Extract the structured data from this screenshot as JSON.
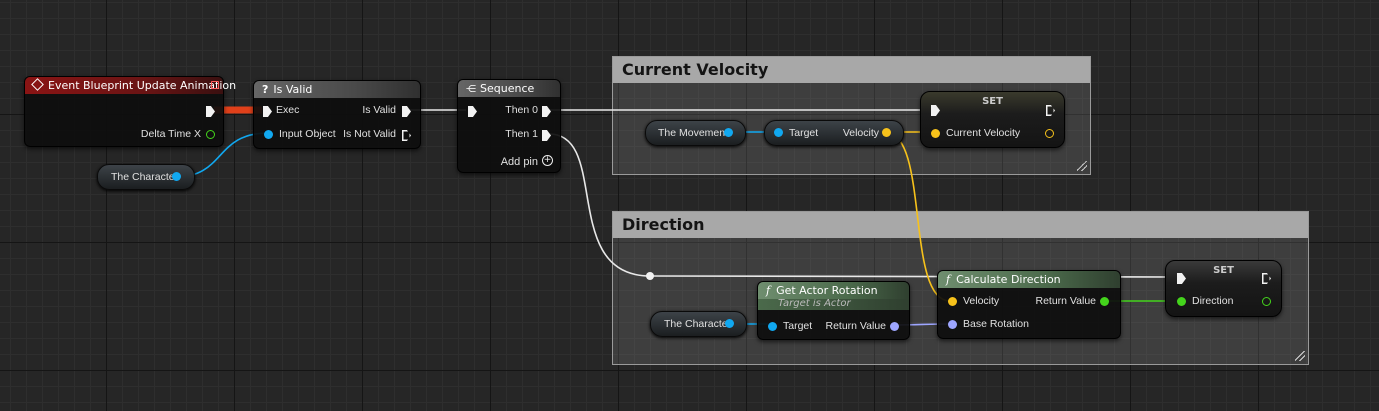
{
  "comments": {
    "current_velocity": "Current Velocity",
    "direction": "Direction"
  },
  "event_node": {
    "title": "Event Blueprint Update Animation",
    "delta_time": "Delta Time X"
  },
  "isvalid_node": {
    "title": "Is Valid",
    "exec": "Exec",
    "input_object": "Input Object",
    "is_valid": "Is Valid",
    "is_not_valid": "Is Not Valid"
  },
  "sequence_node": {
    "title": "Sequence",
    "then0": "Then 0",
    "then1": "Then 1",
    "add_pin": "Add pin"
  },
  "vars": {
    "the_character": "The Character",
    "the_movement": "The Movement",
    "the_character_2": "The Character"
  },
  "velocity_node": {
    "target": "Target",
    "velocity": "Velocity"
  },
  "set_velocity": {
    "title": "SET",
    "current_velocity": "Current Velocity"
  },
  "get_rotation": {
    "title": "Get Actor Rotation",
    "subtitle": "Target is Actor",
    "target": "Target",
    "return_value": "Return Value"
  },
  "calc_direction": {
    "title": "Calculate Direction",
    "velocity": "Velocity",
    "base_rotation": "Base Rotation",
    "return_value": "Return Value"
  },
  "set_direction": {
    "title": "SET",
    "direction": "Direction"
  },
  "colors": {
    "object_pin": "#11a8f0",
    "vector_pin": "#f7c21b",
    "rotator_pin": "#9ea6ff",
    "float_pin": "#44d41c",
    "exec_wire": "#e8e8e8",
    "event_header": "#8a1414"
  },
  "icons": {
    "event": "event-diamond-icon",
    "isvalid": "question-icon",
    "sequence": "sequence-icon",
    "function": "function-icon",
    "add": "add-circle-icon"
  }
}
